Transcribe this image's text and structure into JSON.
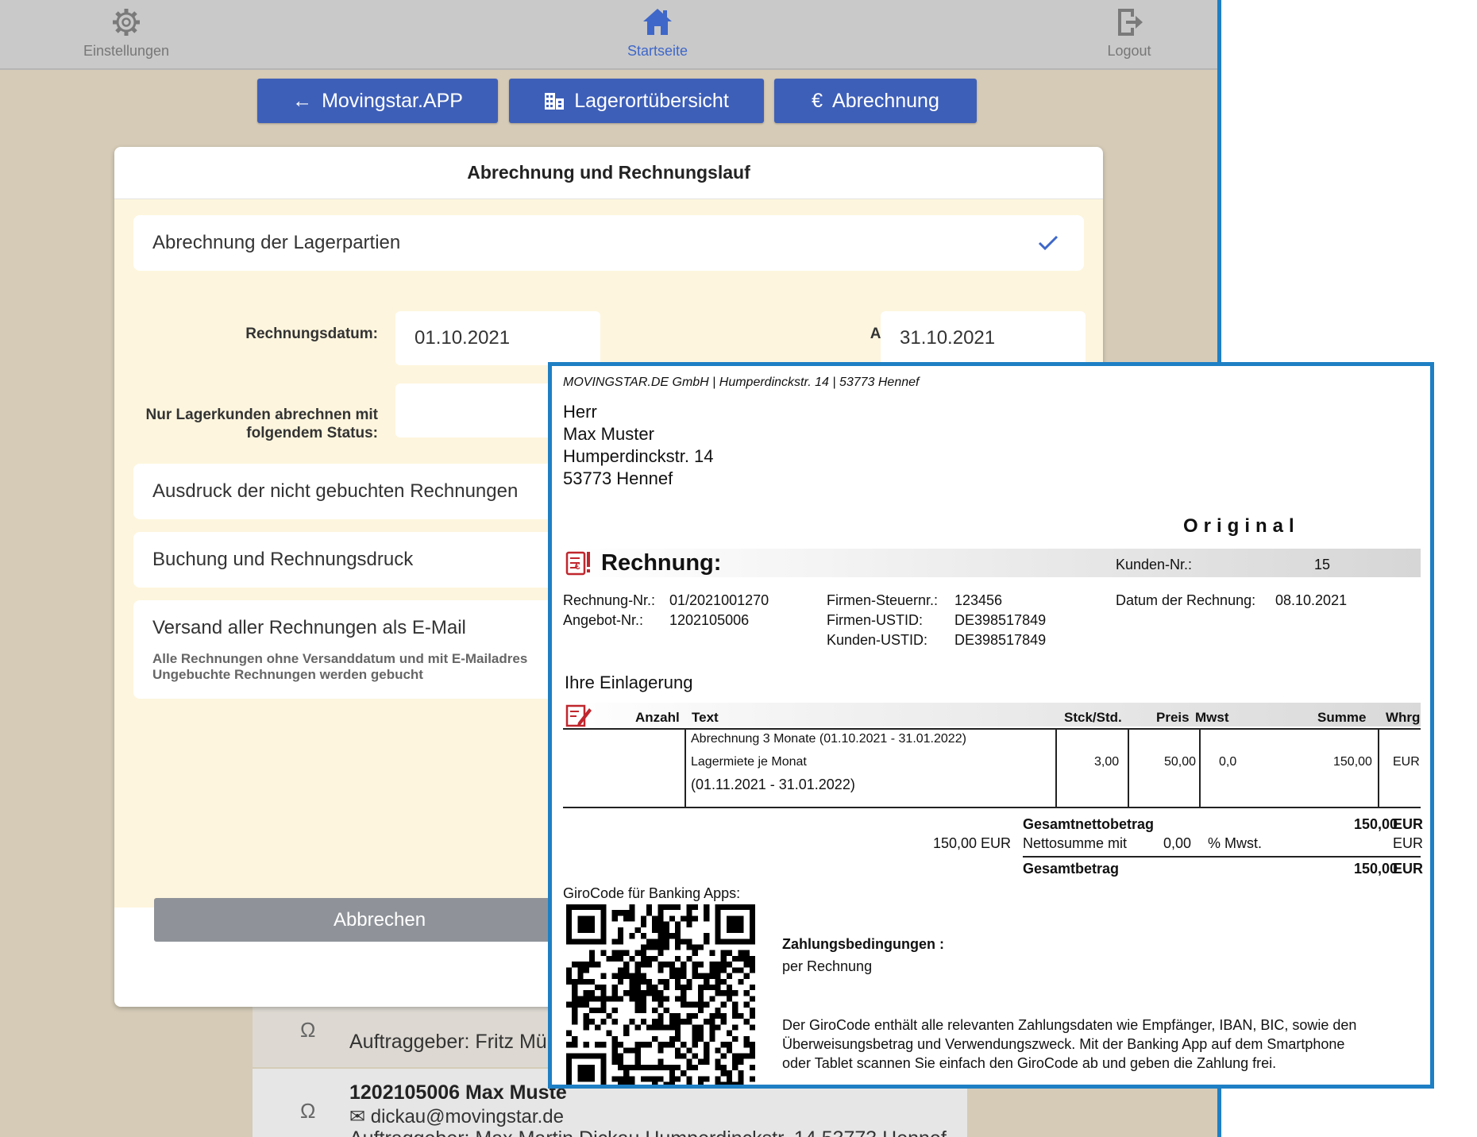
{
  "nav": {
    "settings_label": "Einstellungen",
    "home_label": "Startseite",
    "logout_label": "Logout",
    "settings_icon": "gear-icon",
    "home_icon": "home-icon",
    "logout_icon": "logout-icon",
    "active_color": "#3e67c9"
  },
  "toolbar": {
    "app_label": "Movingstar.APP",
    "storage_label": "Lagerortübersicht",
    "billing_label": "Abrechnung"
  },
  "dialog": {
    "title": "Abrechnung und Rechnungslauf",
    "billing_row": "Abrechnung der Lagerpartien",
    "invoice_date_label": "Rechnungsdatum:",
    "invoice_date_value": "01.10.2021",
    "bill_until_label": "Abrechnen bis:",
    "bill_until_value": "31.10.2021",
    "status_label_1": "Nur Lagerkunden abrechnen mit",
    "status_label_2": "folgendem Status:",
    "print_row": "Ausdruck der nicht gebuchten Rechnungen",
    "booking_row": "Buchung und Rechnungsdruck",
    "email_row": "Versand aller Rechnungen als E-Mail",
    "email_sub_1": "Alle Rechnungen ohne Versanddatum und mit E-Mailadres",
    "email_sub_2": "Ungebuchte Rechnungen werden gebucht",
    "cancel_label": "Abbrechen"
  },
  "background_list": {
    "item1_client": "Auftraggeber: Fritz Mülle",
    "item2_title": "1202105006 Max Muste",
    "item2_email": "dickau@movingstar.de",
    "item2_client": "Auftraggeber: Max Martin Dickau Humperdinckstr. 14 53773 Hennef"
  },
  "invoice": {
    "sender_line": "MOVINGSTAR.DE GmbH  |  Humperdinckstr. 14  |  53773 Hennef",
    "recipient": [
      "Herr",
      "Max Muster",
      "Humperdinckstr. 14",
      "53773 Hennef"
    ],
    "original_label": "Original",
    "title": "Rechnung:",
    "customer_no_label": "Kunden-Nr.:",
    "customer_no": "15",
    "invoice_no_label": "Rechnung-Nr.:",
    "invoice_no": "01/2021001270",
    "offer_no_label": "Angebot-Nr.:",
    "offer_no": "1202105006",
    "tax_no_label": "Firmen-Steuernr.:",
    "tax_no": "123456",
    "company_vat_label": "Firmen-USTID:",
    "company_vat": "DE398517849",
    "customer_vat_label": "Kunden-USTID:",
    "customer_vat": "DE398517849",
    "date_label": "Datum der Rechnung:",
    "date": "08.10.2021",
    "section_title": "Ihre Einlagerung",
    "columns": {
      "qty": "Anzahl",
      "text": "Text",
      "units": "Stck/Std.",
      "price": "Preis",
      "vat": "Mwst",
      "sum": "Summe",
      "currency": "Whrg"
    },
    "line": {
      "text1": "Abrechnung 3 Monate (01.10.2021 - 31.01.2022)",
      "text2": "Lagermiete je Monat",
      "text3": "(01.11.2021 - 31.01.2022)",
      "units": "3,00",
      "price": "50,00",
      "vat": "0,0",
      "sum": "150,00",
      "currency": "EUR"
    },
    "totals": {
      "net_label": "Gesamtnettobetrag",
      "net_value": "150,00",
      "net_currency": "EUR",
      "net_sum_amount": "150,00 EUR",
      "net_sum_label": "Nettosumme mit",
      "vat_amount": "0,00",
      "vat_label": "% Mwst.",
      "vat_currency": "EUR",
      "total_label": "Gesamtbetrag",
      "total_value": "150,00",
      "total_currency": "EUR"
    },
    "girocode_label": "GiroCode für Banking Apps:",
    "payment_terms_label": "Zahlungsbedingungen :",
    "payment_terms_value": "per Rechnung",
    "giro_text_1": "Der GiroCode enthält alle relevanten Zahlungsdaten wie Empfänger, IBAN, BIC, sowie den",
    "giro_text_2": "Überweisungsbetrag und Verwendungszweck. Mit der Banking App auf dem Smartphone",
    "giro_text_3": "oder Tablet scannen Sie einfach den GiroCode ab und geben die Zahlung frei.",
    "icon_color": "#c0262d"
  }
}
